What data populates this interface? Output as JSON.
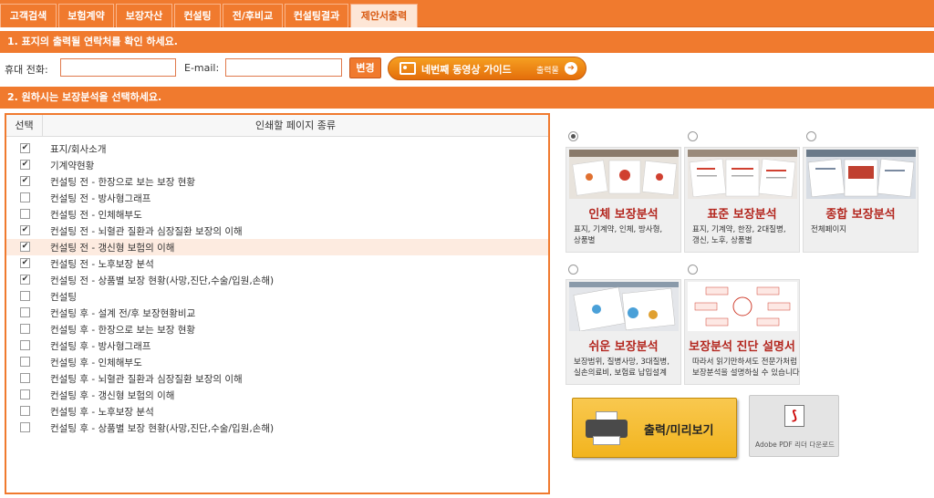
{
  "tabs": [
    {
      "label": "고객검색"
    },
    {
      "label": "보험계약"
    },
    {
      "label": "보장자산"
    },
    {
      "label": "컨설팅"
    },
    {
      "label": "전/후비교"
    },
    {
      "label": "컨설팅결과"
    },
    {
      "label": "제안서출력"
    }
  ],
  "section1": {
    "title": "1. 표지의 출력될 연락처를 확인 하세요."
  },
  "contact": {
    "phone_label": "휴대 전화:",
    "phone_value": "",
    "email_label": "E-mail:",
    "email_value": "",
    "change_button": "변경",
    "guide_label": "네번째 동영상 가이드",
    "guide_sub": "출력물"
  },
  "section2": {
    "title": "2. 원하시는 보장분석을 선택하세요."
  },
  "page_table": {
    "col_select": "선택",
    "col_type": "인쇄할 페이지 종류",
    "rows": [
      {
        "label": "표지/회사소개",
        "checked": true
      },
      {
        "label": "기계약현황",
        "checked": true
      },
      {
        "label": "컨설팅 전 - 한장으로 보는 보장 현황",
        "checked": true
      },
      {
        "label": "컨설팅 전 - 방사형그래프",
        "checked": false
      },
      {
        "label": "컨설팅 전 - 인체해부도",
        "checked": false
      },
      {
        "label": "컨설팅 전 - 뇌혈관 질환과 심장질환 보장의 이해",
        "checked": true
      },
      {
        "label": "컨설팅 전 - 갱신형 보험의 이해",
        "checked": true
      },
      {
        "label": "컨설팅 전 - 노후보장 분석",
        "checked": true
      },
      {
        "label": "컨설팅 전 - 상품별 보장 현황(사망,진단,수술/입원,손해)",
        "checked": true
      },
      {
        "label": "컨설팅",
        "checked": false
      },
      {
        "label": "컨설팅 후 - 설계 전/후 보장현황비교",
        "checked": false
      },
      {
        "label": "컨설팅 후 - 한장으로 보는 보장 현황",
        "checked": false
      },
      {
        "label": "컨설팅 후 - 방사형그래프",
        "checked": false
      },
      {
        "label": "컨설팅 후 - 인체해부도",
        "checked": false
      },
      {
        "label": "컨설팅 후 - 뇌혈관 질환과 심장질환 보장의 이해",
        "checked": false
      },
      {
        "label": "컨설팅 후 - 갱신형 보험의 이해",
        "checked": false
      },
      {
        "label": "컨설팅 후 - 노후보장 분석",
        "checked": false
      },
      {
        "label": "컨설팅 후 - 상품별 보장 현황(사망,진단,수술/입원,손해)",
        "checked": false
      }
    ]
  },
  "analysis_options": [
    {
      "title": "인체 보장분석",
      "desc": "표지, 기계약, 인체, 방사형,\n상품별",
      "selected": true
    },
    {
      "title": "표준 보장분석",
      "desc": "표지, 기계약, 한장, 2대질병,\n갱신, 노후, 상품별",
      "selected": false
    },
    {
      "title": "종합 보장분석",
      "desc": "전체페이지",
      "selected": false
    },
    {
      "title": "쉬운 보장분석",
      "desc": "보장범위, 질병사망, 3대질병,\n실손의료비, 보험료 납입설계",
      "selected": false
    },
    {
      "title": "보장분석 진단 설명서",
      "desc": "따라서 읽기만하셔도 전문가처럼\n보장분석을 설명하실 수 있습니다",
      "selected": false
    }
  ],
  "print_button": {
    "label": "출력/미리보기"
  },
  "pdf_download": {
    "label": "Adobe PDF 리더 다운로드"
  }
}
